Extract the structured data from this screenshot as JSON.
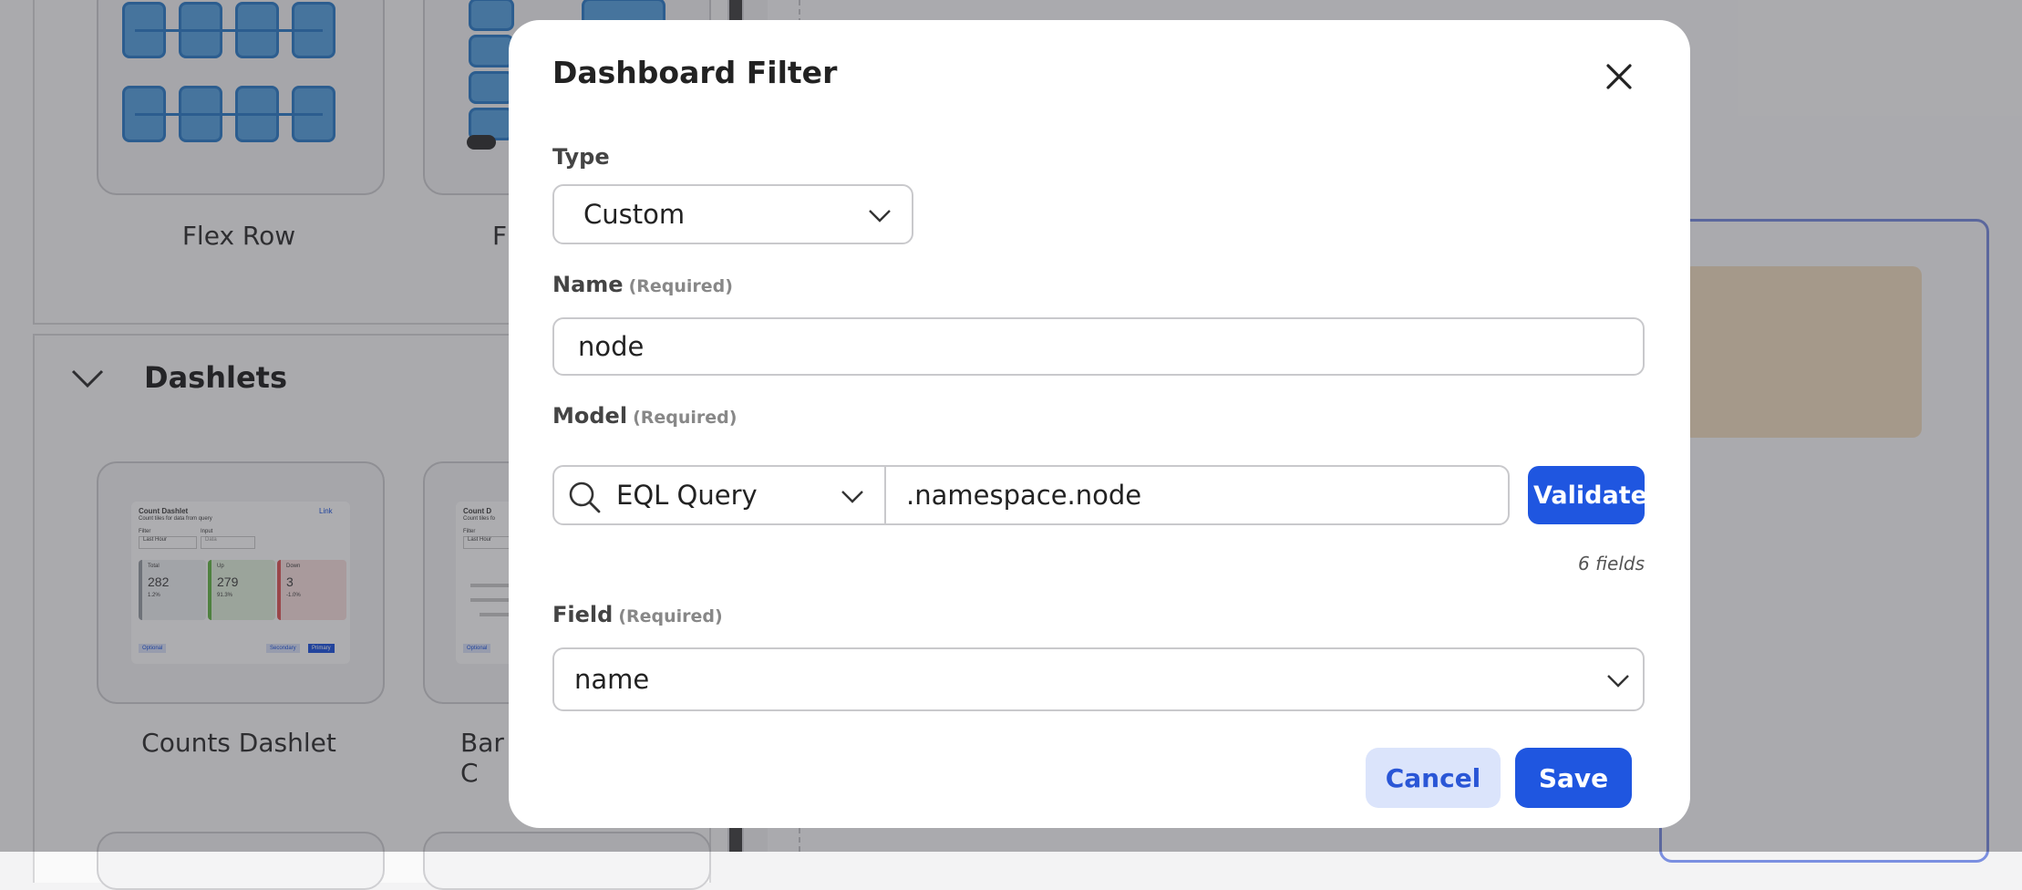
{
  "background": {
    "layout_cards": [
      {
        "label": "Flex Row"
      },
      {
        "label": "Fl"
      }
    ],
    "dashlets_section_title": "Dashlets",
    "dashlet_cards": [
      {
        "label": "Counts Dashlet"
      },
      {
        "label": "Bar C"
      }
    ],
    "counts_thumb": {
      "title": "Count Dashlet",
      "subtitle": "Count tiles for data from query",
      "link": "Link",
      "filter_label": "Filter",
      "input_label": "Input",
      "filter_value": "Last Hour",
      "input_placeholder": "Data",
      "tiles": [
        {
          "label": "Total",
          "value": "282",
          "pct": "1.2%",
          "color": "#9aa0a6"
        },
        {
          "label": "Up",
          "value": "279",
          "pct": "91.3%",
          "color": "#67b94a"
        },
        {
          "label": "Down",
          "value": "3",
          "pct": "-1.0%",
          "color": "#e05a5a"
        }
      ],
      "optional": "Optional",
      "secondary": "Secondary",
      "primary": "Primary"
    },
    "bar_thumb": {
      "title": "Count D",
      "subtitle": "Count tiles fo",
      "filter_label": "Filter",
      "filter_value": "Last Hour",
      "optional": "Optional"
    }
  },
  "modal": {
    "title": "Dashboard Filter",
    "type_label": "Type",
    "type_value": "Custom",
    "name_label": "Name",
    "required_text": "(Required)",
    "name_value": "node",
    "model_label": "Model",
    "model_type": "EQL Query",
    "model_query": ".namespace.node",
    "validate_label": "Validate",
    "field_count": "6 fields",
    "field_label": "Field",
    "field_value": "name",
    "cancel_label": "Cancel",
    "save_label": "Save"
  },
  "colors": {
    "primary": "#1f56e0",
    "secondary_bg": "#dbe4fb",
    "secondary_text": "#2a56d6"
  }
}
